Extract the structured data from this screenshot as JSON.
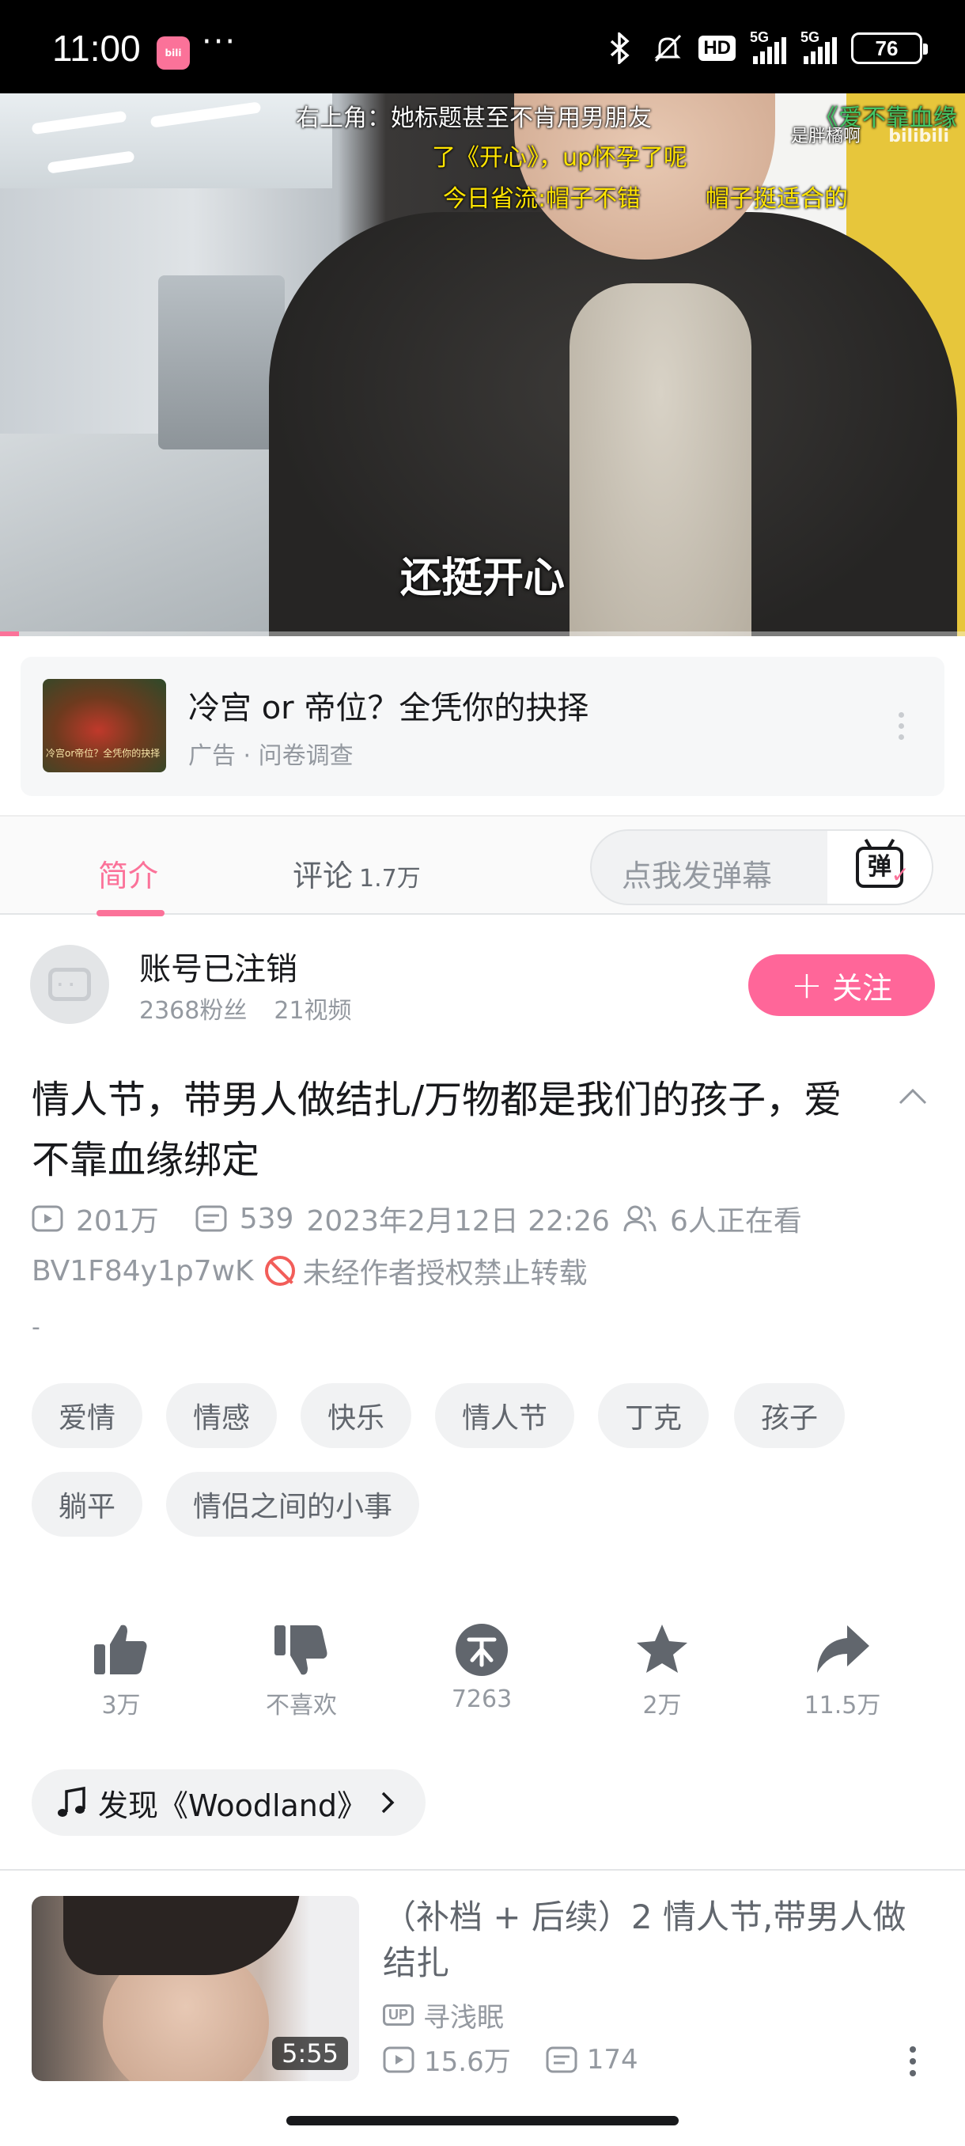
{
  "status_bar": {
    "time": "11:00",
    "app_icon": "bilibili",
    "more": "···",
    "hd": "HD",
    "net1": "5G",
    "net2": "5G",
    "battery": "76"
  },
  "video": {
    "danmaku": [
      {
        "text": "右上角：她标题甚至不肯用男朋友",
        "color": "#ffffff"
      },
      {
        "text": "《爱不靠血缘",
        "color": "#44c767"
      },
      {
        "text": "是胖橘啊",
        "color": "#ffffff"
      },
      {
        "text": "了《开心》，up怀孕了呢",
        "color": "#ffe400"
      },
      {
        "text": "今日省流:帽子不错",
        "color": "#ffe400"
      },
      {
        "text": "帽子挺适合的",
        "color": "#ffe400"
      }
    ],
    "watermark": "bilibili",
    "subtitle": "还挺开心",
    "progress": 0.02
  },
  "ad": {
    "thumb_caption": "冷宫or帝位？全凭你的抉择",
    "title": "冷宫 or 帝位？全凭你的抉择",
    "subtitle": "广告 · 问卷调查"
  },
  "tabs": {
    "intro": "简介",
    "comments": "评论",
    "comments_count": "1.7万",
    "danmaku_placeholder": "点我发弹幕",
    "danmaku_button": "弹"
  },
  "uploader": {
    "name": "账号已注销",
    "followers": "2368粉丝",
    "videos": "21视频",
    "follow_label": "关注"
  },
  "detail": {
    "title": "情人节，带男人做结扎/万物都是我们的孩子，爱不靠血缘绑定",
    "views": "201万",
    "danmaku_count": "539",
    "date": "2023年2月12日 22:26",
    "watching": "6人正在看",
    "bvid": "BV1F84y1p7wK",
    "no_repost": "未经作者授权禁止转载",
    "description": "-"
  },
  "tags": [
    "爱情",
    "情感",
    "快乐",
    "情人节",
    "丁克",
    "孩子",
    "躺平",
    "情侣之间的小事"
  ],
  "actions": {
    "like": "3万",
    "dislike": "不喜欢",
    "coin": "7263",
    "favorite": "2万",
    "share": "11.5万"
  },
  "music": {
    "label": "发现《Woodland》"
  },
  "recommend": {
    "duration": "5:55",
    "title": "（补档 + 后续）2  情人节,带男人做结扎",
    "up_badge": "UP",
    "up_name": "寻浅眠",
    "views": "15.6万",
    "danmaku": "174"
  },
  "colors": {
    "brand": "#fb7299",
    "follow": "#ff6699",
    "text": "#18191c",
    "muted": "#9499a0"
  }
}
